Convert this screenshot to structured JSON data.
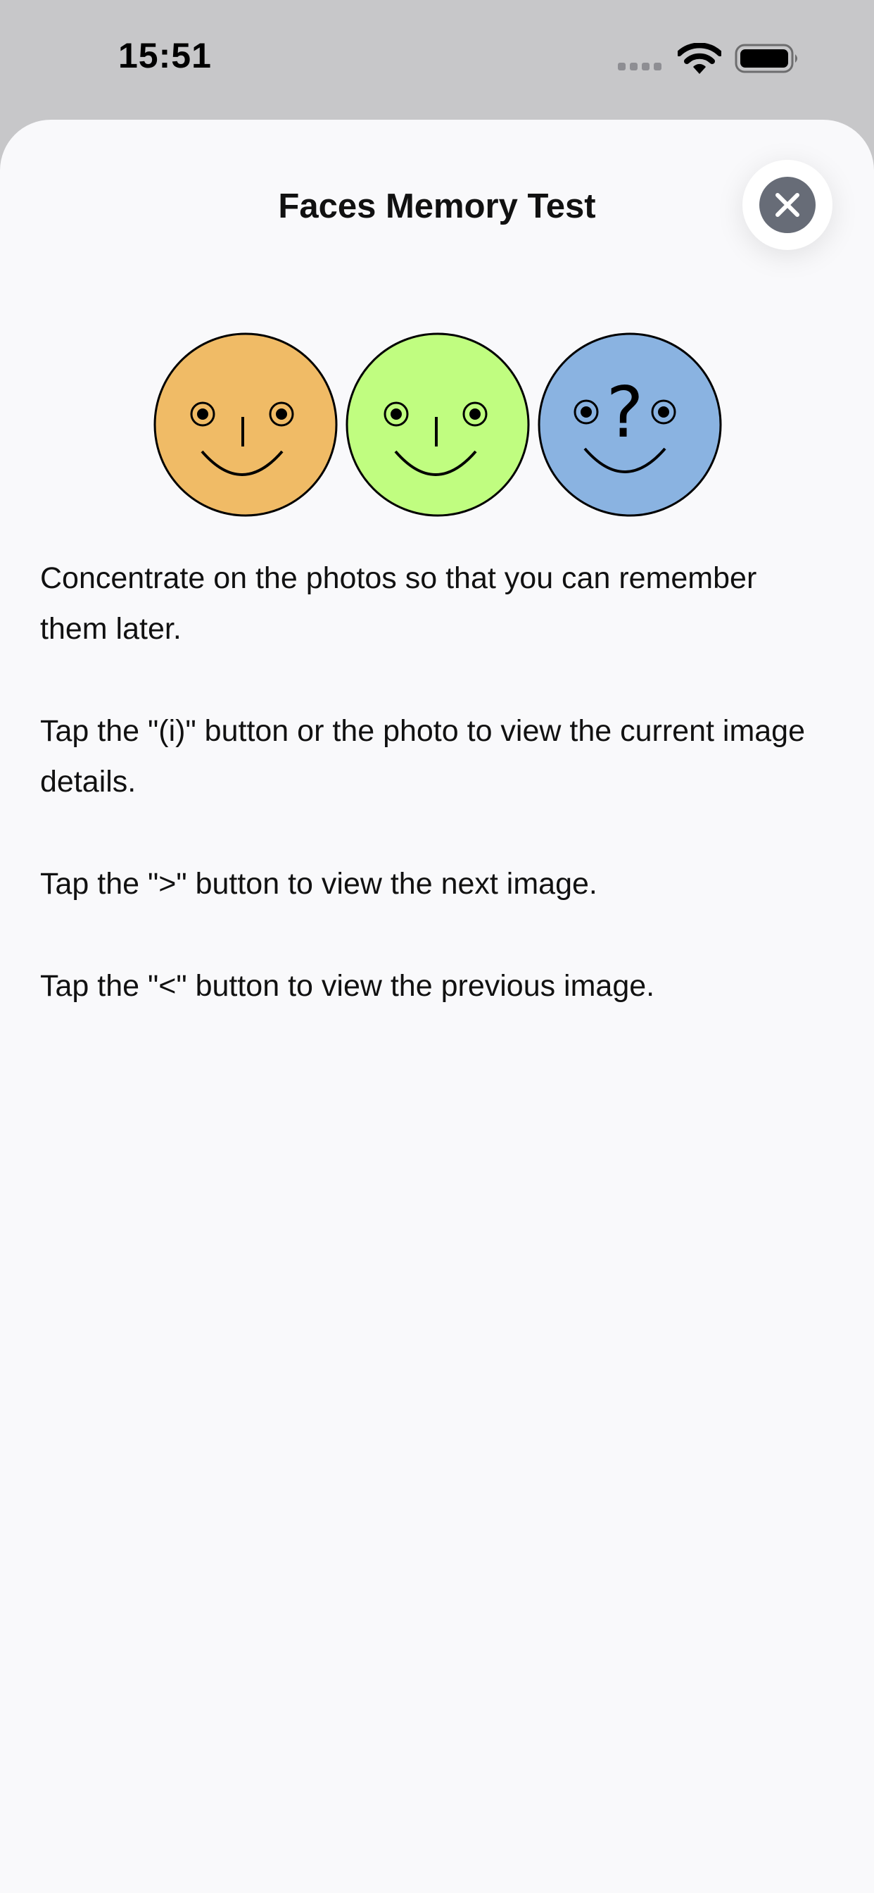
{
  "status_bar": {
    "time": "15:51",
    "icons": [
      "cellular-signal-icon",
      "wifi-icon",
      "battery-icon"
    ]
  },
  "sheet": {
    "title": "Faces Memory Test",
    "close_icon": "close-icon"
  },
  "faces": [
    {
      "name": "orange-face",
      "color": "#f0bb66",
      "mystery": false
    },
    {
      "name": "green-face",
      "color": "#c0fd80",
      "mystery": false
    },
    {
      "name": "blue-face",
      "color": "#8ab3e1",
      "mystery": true,
      "mark": "?"
    }
  ],
  "instructions": [
    "Concentrate on the photos so that you can remember them later.",
    "Tap the \"(i)\" button or the photo to view the current image details.",
    "Tap the \">\" button to view the next image.",
    "Tap the \"<\" button to view the previous image."
  ]
}
